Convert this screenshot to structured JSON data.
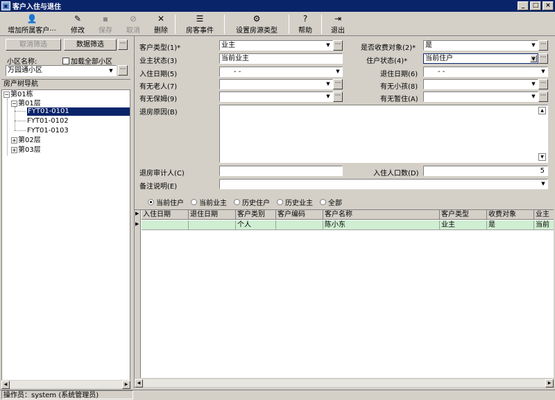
{
  "window": {
    "title": "客户入住与退住",
    "icon": "app-icon",
    "controls": [
      "_",
      "□",
      "×"
    ]
  },
  "toolbar": {
    "add_label": "增加所属客户···",
    "edit_label": "修改",
    "save_label": "保存",
    "cancel_label": "取消",
    "delete_label": "删除",
    "events_label": "房客事件",
    "set_type_label": "设置房源类型",
    "help_label": "帮助",
    "exit_label": "退出"
  },
  "sidebar": {
    "cancel_filter": "取消筛选",
    "data_filter": "数据筛选",
    "ellipsis": "···",
    "community_label": "小区名称:",
    "load_all_label": "加载全部小区",
    "community_value": "万园通小区",
    "tree_header": "房产树导航",
    "tree": {
      "building": "第01栋",
      "floor1": "第01层",
      "room1": "FYT01-0101",
      "room2": "FYT01-0102",
      "room3": "FYT01-0103",
      "floor2": "第02层",
      "floor3": "第03层"
    }
  },
  "form": {
    "customer_type_label": "客户类型(1)*",
    "customer_type_value": "业主",
    "is_charge_label": "是否收费对象(2)*",
    "is_charge_value": "是",
    "owner_status_label": "业主状态(3)",
    "owner_status_value": "当前业主",
    "resident_status_label": "住户状态(4)*",
    "resident_status_value": "当前住户",
    "checkin_date_label": "入住日期(5)",
    "checkin_date_value": "- -",
    "checkout_date_label": "退住日期(6)",
    "checkout_date_value": "- -",
    "elderly_label": "有无老人(7)",
    "children_label": "有无小孩(8)",
    "nanny_label": "有无保姆(9)",
    "temp_label": "有无暂住(A)",
    "checkout_reason_label": "退房原因(B)",
    "auditor_label": "退房审计人(C)",
    "occupants_label": "入住人口数(D)",
    "occupants_value": "5",
    "remarks_label": "备注说明(E)"
  },
  "filter_radios": [
    "当前住户",
    "当前业主",
    "历史住户",
    "历史业主",
    "全部"
  ],
  "grid": {
    "columns": [
      "入住日期",
      "退住日期",
      "客户类别",
      "客户编码",
      "客户名称",
      "客户类型",
      "收费对象",
      "业主"
    ],
    "rows": [
      [
        "",
        "",
        "个人",
        "",
        "陈小东",
        "业主",
        "是",
        "当前"
      ]
    ]
  },
  "status": {
    "operator": "操作员：system (系统管理员)"
  },
  "colors": {
    "title_bar": "#0a246a",
    "selected": "#0a246a",
    "row_highlight": "#cfeed2",
    "panel": "#d4d0c8"
  }
}
